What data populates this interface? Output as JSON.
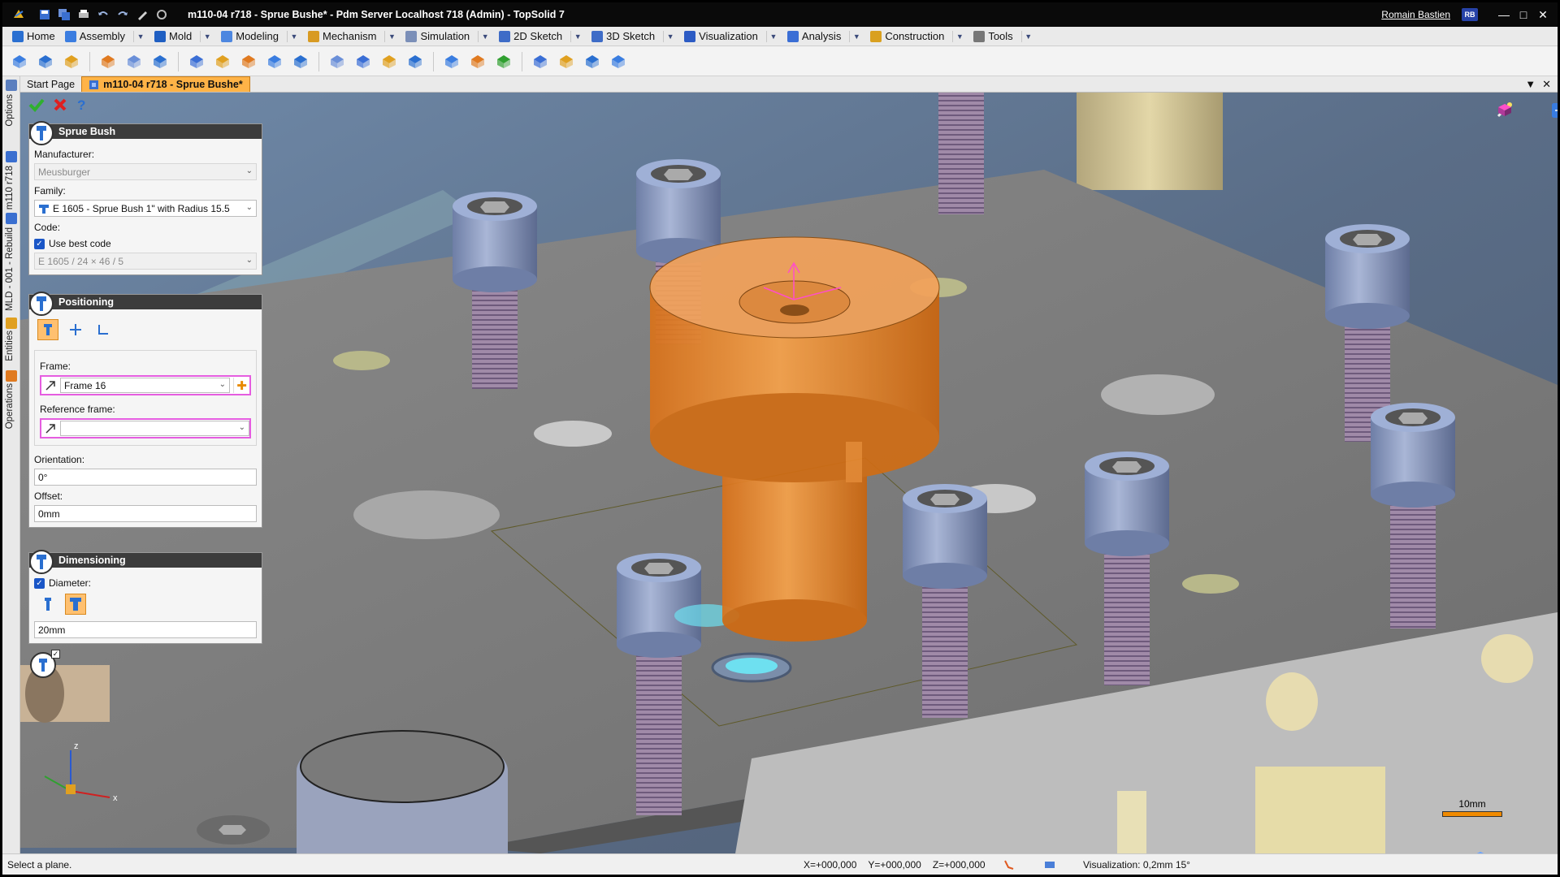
{
  "window": {
    "title": "m110-04 r718 - Sprue Bushe* - Pdm Server Localhost 718 (Admin) - TopSolid 7",
    "user": "Romain Bastien",
    "user_initials": "RB"
  },
  "menu": {
    "items": [
      {
        "label": "Home",
        "color": "#2a6fd1"
      },
      {
        "label": "Assembly",
        "color": "#3b7de0"
      },
      {
        "label": "Mold",
        "color": "#1f5fc2"
      },
      {
        "label": "Modeling",
        "color": "#4d87e0"
      },
      {
        "label": "Mechanism",
        "color": "#d89a22"
      },
      {
        "label": "Simulation",
        "color": "#7b8fb8"
      },
      {
        "label": "2D Sketch",
        "color": "#3e6cc7"
      },
      {
        "label": "3D Sketch",
        "color": "#3e6cc7"
      },
      {
        "label": "Visualization",
        "color": "#2c5bc4"
      },
      {
        "label": "Analysis",
        "color": "#3a6ed5"
      },
      {
        "label": "Construction",
        "color": "#d9a020"
      },
      {
        "label": "Tools",
        "color": "#777777"
      }
    ]
  },
  "tabs": {
    "start": "Start Page",
    "active": "m110-04 r718 - Sprue Bushe*"
  },
  "sidebar": {
    "options": "Options",
    "doc": "m110 r718",
    "mld": "MLD - 001 - Rebuild",
    "entities": "Entities",
    "operations": "Operations"
  },
  "panel_sprue": {
    "title": "Sprue Bush",
    "manufacturer_label": "Manufacturer:",
    "manufacturer_value": "Meusburger",
    "family_label": "Family:",
    "family_value": "E 1605 - Sprue Bush 1\" with Radius 15.5",
    "code_label": "Code:",
    "use_best_code": "Use best code",
    "code_value": "E 1605 / 24 × 46 / 5"
  },
  "panel_positioning": {
    "title": "Positioning",
    "frame_label": "Frame:",
    "frame_value": "Frame 16",
    "reference_frame_label": "Reference frame:",
    "reference_frame_value": "",
    "orientation_label": "Orientation:",
    "orientation_value": "0°",
    "offset_label": "Offset:",
    "offset_value": "0mm"
  },
  "panel_dimensioning": {
    "title": "Dimensioning",
    "diameter_label": "Diameter:",
    "diameter_value": "20mm"
  },
  "viewport": {
    "scale_label": "10mm"
  },
  "status": {
    "message": "Select a plane.",
    "x": "X=+000,000",
    "y": "Y=+000,000",
    "z": "Z=+000,000",
    "visualization": "Visualization: 0,2mm 15°"
  },
  "colors": {
    "accent": "#ffb347",
    "sprue": "#f08a1e",
    "screw_head": "#8fa0c4",
    "screw_thread": "#9b7fa3",
    "plate": "#747474"
  }
}
